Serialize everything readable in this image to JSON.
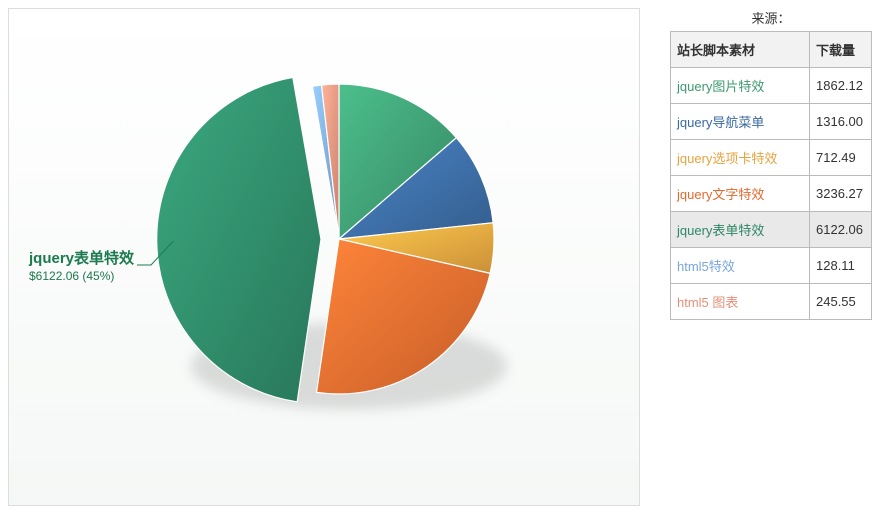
{
  "chart_data": {
    "type": "pie",
    "series": [
      {
        "name": "jquery图片特效",
        "value": 1862.12,
        "color": "#3d9970"
      },
      {
        "name": "jquery导航菜单",
        "value": 1316.0,
        "color": "#3b6aa0"
      },
      {
        "name": "jquery选项卡特效",
        "value": 712.49,
        "color": "#e7a33e"
      },
      {
        "name": "jquery文字特效",
        "value": 3236.27,
        "color": "#e26a2e"
      },
      {
        "name": "jquery表单特效",
        "value": 6122.06,
        "color": "#2e8766",
        "selected": true
      },
      {
        "name": "html5特效",
        "value": 128.11,
        "color": "#7aa6d8"
      },
      {
        "name": "html5 图表",
        "value": 245.55,
        "color": "#e4907a"
      }
    ],
    "callout": {
      "name": "jquery表单特效",
      "value_text": "$6122.06 (45%)"
    }
  },
  "table": {
    "title": "来源：",
    "headers": {
      "col1": "站长脚本素材",
      "col2": "下载量"
    }
  }
}
